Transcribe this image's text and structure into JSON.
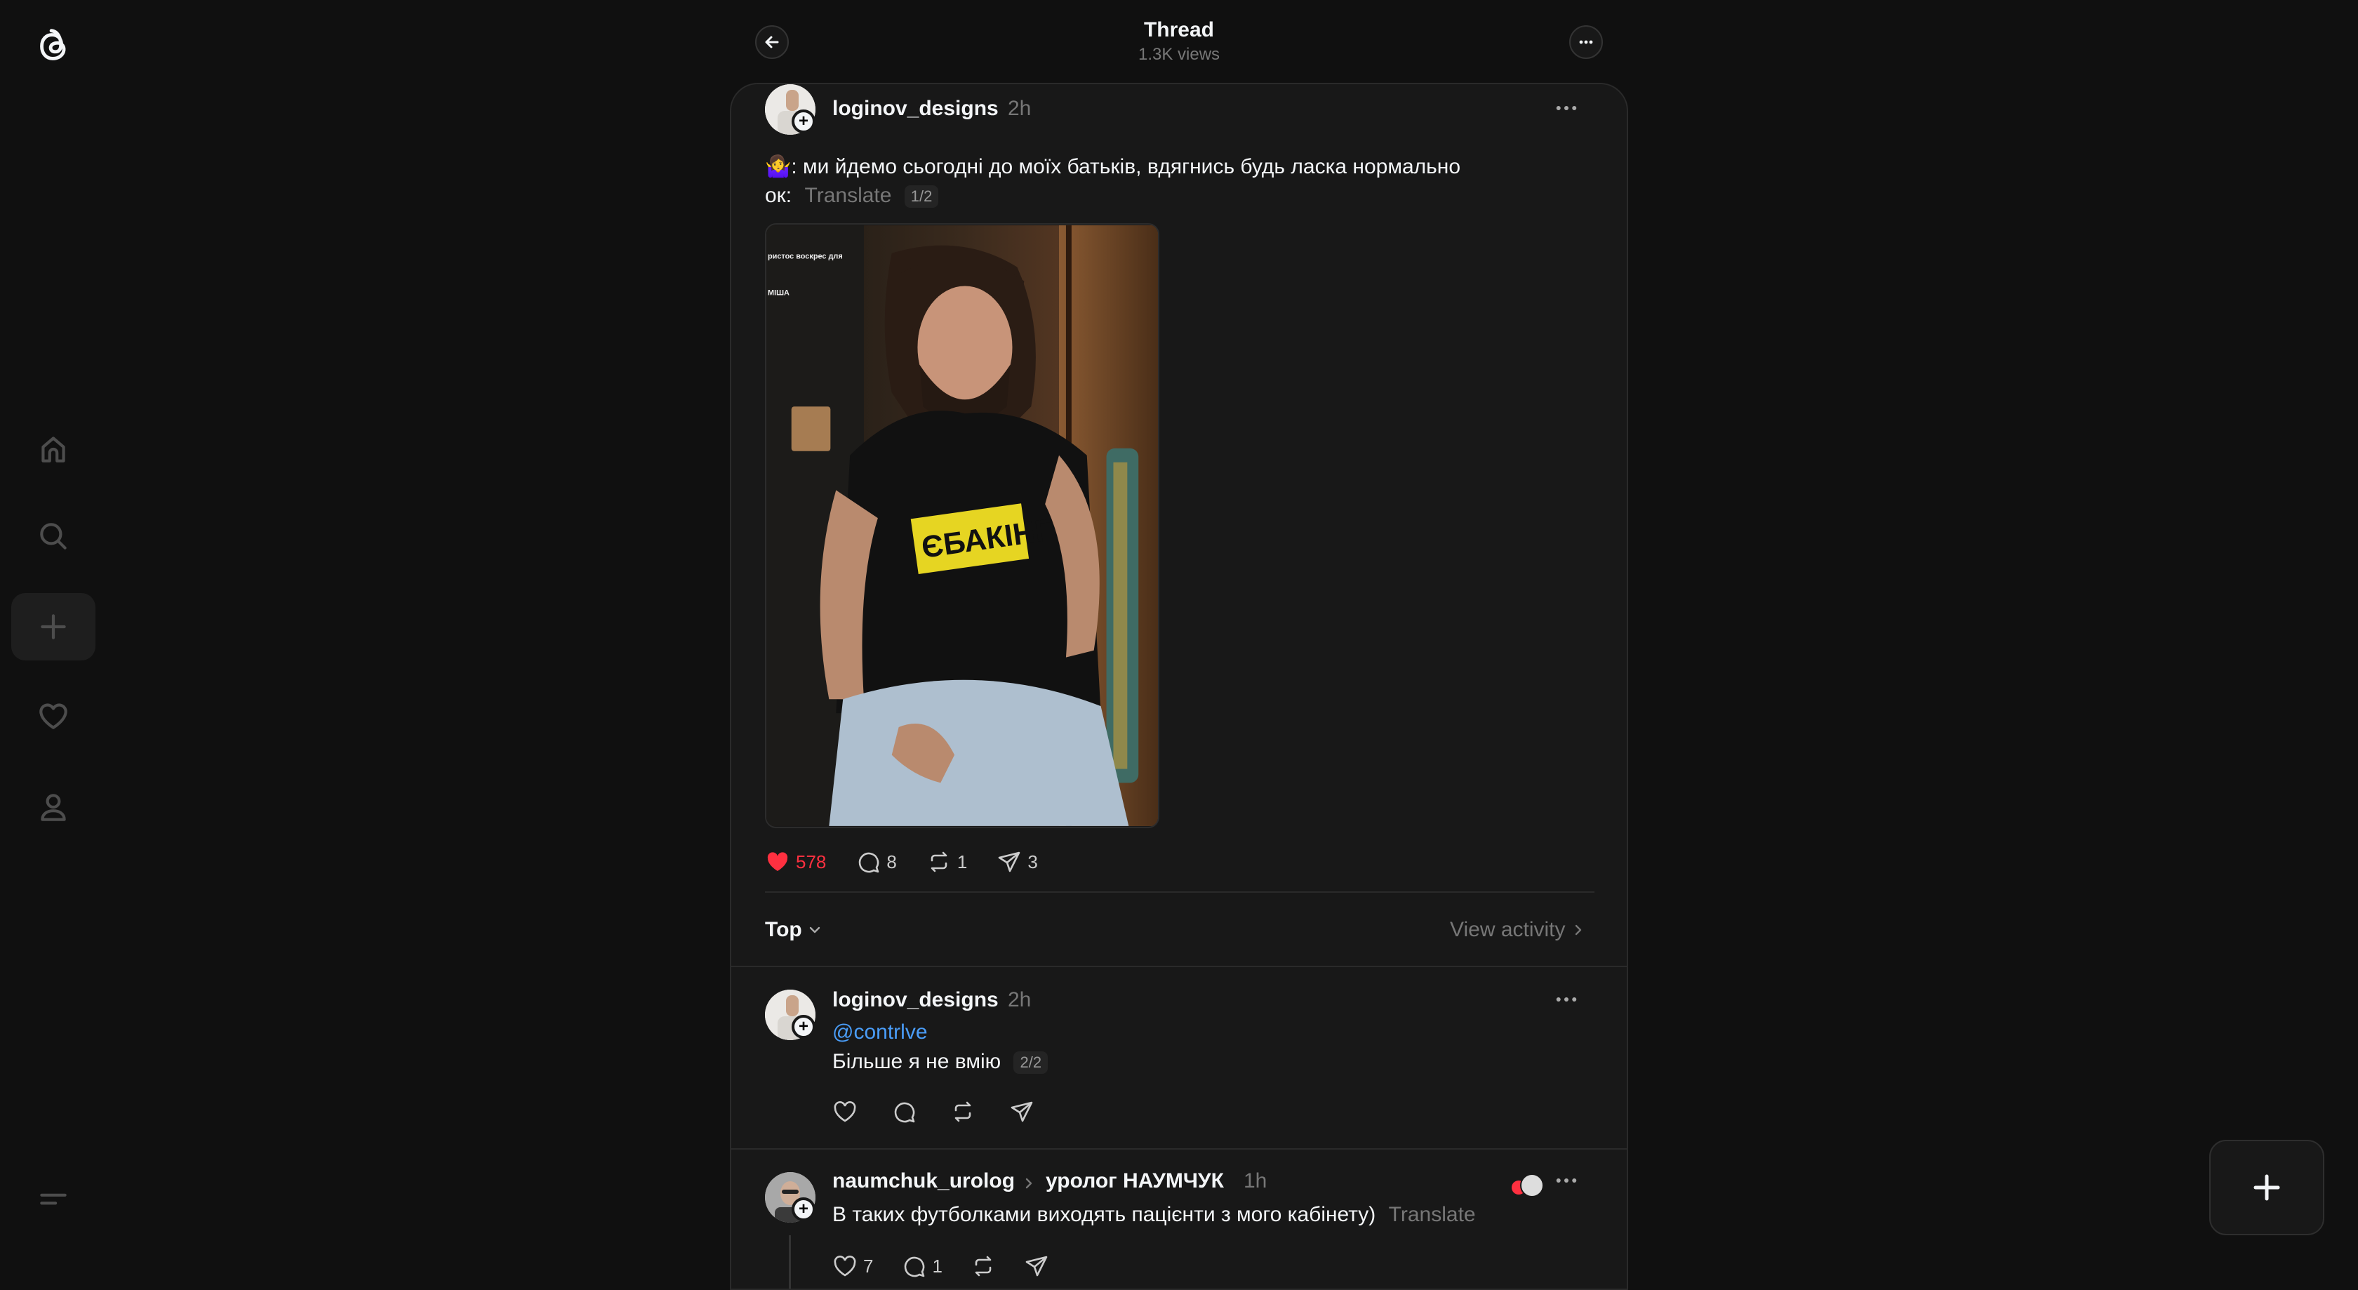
{
  "header": {
    "title": "Thread",
    "views": "1.3K views"
  },
  "post": {
    "username": "loginov_designs",
    "time": "2h",
    "text_line1": "🤷‍♀️: ми йдемо сьогодні до моїх батьків, вдягнись будь ласка нормально",
    "text_line2": "ок:",
    "translate": "Translate",
    "counter": "1/2",
    "image": {
      "overlay_line1": "ристос воскрес для",
      "overlay_line2": "МІША",
      "shirt_text": "ЄБАКІНГ"
    },
    "likes": "578",
    "replies": "8",
    "reposts": "1",
    "shares": "3"
  },
  "sort": {
    "label": "Top",
    "view_activity": "View activity"
  },
  "replies": [
    {
      "username": "loginov_designs",
      "time": "2h",
      "mention": "@contrlve",
      "text": "Більше я не вмію",
      "counter": "2/2"
    },
    {
      "username": "naumchuk_urolog",
      "reply_to": "уролог НАУМЧУК",
      "time": "1h",
      "text": "В таких футболками виходять пацієнти з мого кабінету)",
      "translate": "Translate",
      "likes": "7",
      "replies": "1"
    }
  ],
  "colors": {
    "background": "#101010",
    "card": "#181818",
    "like": "#ff3040",
    "mention": "#4a9df8"
  },
  "icons": [
    "threads-logo-icon",
    "home-icon",
    "search-icon",
    "plus-icon",
    "heart-icon",
    "profile-icon",
    "menu-icon",
    "back-arrow-icon",
    "more-icon",
    "comment-icon",
    "repost-icon",
    "share-icon",
    "chevron-down-icon",
    "chevron-right-icon"
  ]
}
